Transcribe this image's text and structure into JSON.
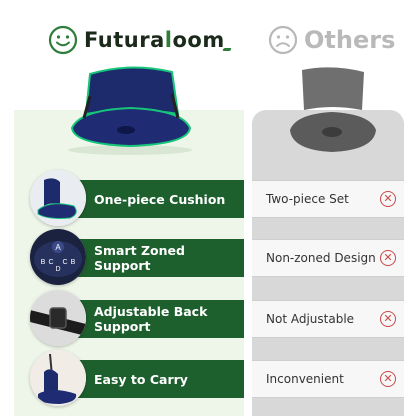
{
  "brand": {
    "name_part1": "Futura",
    "name_leaf": "l",
    "name_part2": "oom"
  },
  "others": {
    "title": "Others"
  },
  "features": [
    {
      "label": "One-piece Cushion",
      "other": "Two-piece Set",
      "icon": "one-piece-cushion"
    },
    {
      "label": "Smart Zoned Support",
      "other": "Non-zoned Design",
      "icon": "zoned-support"
    },
    {
      "label": "Adjustable Back Support",
      "other": "Not Adjustable",
      "icon": "adjustable-strap"
    },
    {
      "label": "Easy to Carry",
      "other": "Inconvenient",
      "icon": "carry"
    }
  ],
  "zones": {
    "a": "A",
    "b1": "B",
    "c1": "C",
    "d": "D",
    "c2": "C",
    "b2": "B"
  },
  "colors": {
    "brand_green": "#1e5f2e",
    "light_green_bg": "#eef6e9",
    "grey_bg": "#d8d8d8",
    "x_red": "#c94848"
  },
  "icons": {
    "brand": "smile-icon",
    "others": "frown-icon",
    "negative": "x-circle-icon"
  }
}
